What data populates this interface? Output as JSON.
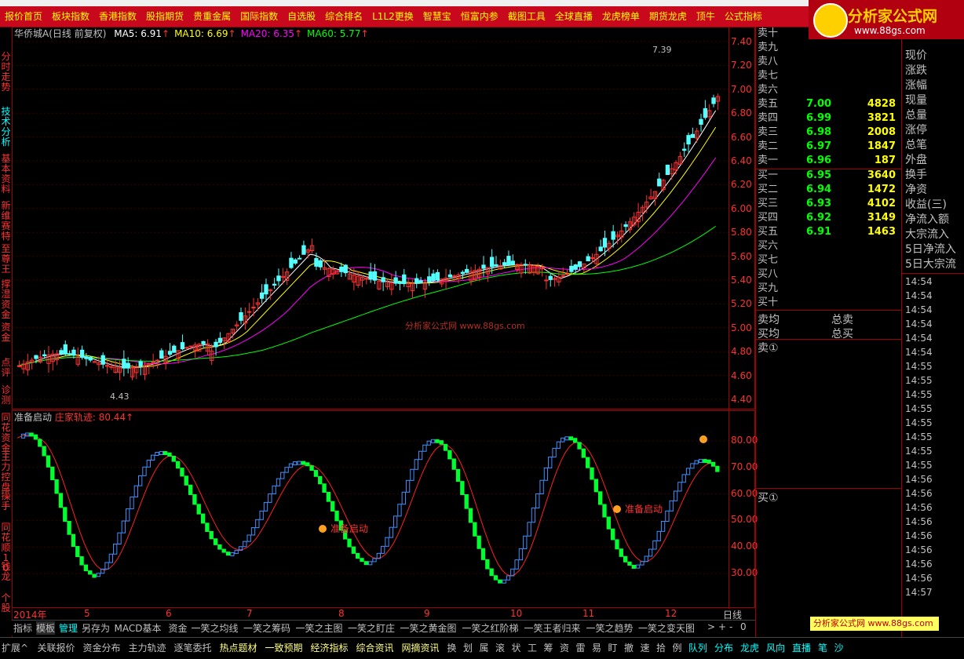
{
  "top_menu": [
    "报价首页",
    "板块指数",
    "香港指数",
    "股指期货",
    "贵重金属",
    "国际指数",
    "自选股",
    "综合排名",
    "L1L2更换",
    "智慧宝",
    "恒富内参",
    "截图工具",
    "全球直播",
    "龙虎榜单",
    "期货龙虎",
    "顶牛",
    "公式指标"
  ],
  "logo": {
    "title": "分析家公式网",
    "url": "www.88gs.com"
  },
  "left_tabs": [
    "分时走势",
    "技术分析",
    "基本资料",
    "新维赛特",
    "至尊王",
    "撑湿资金",
    "资金",
    "点评",
    "诊测",
    "同花资金",
    "主力控盘",
    "操手",
    "同花顺10",
    "钱龙",
    "个股"
  ],
  "price_chart": {
    "stock_name": "华侨城A(日线 前复权)",
    "ma": [
      {
        "label": "MA5:",
        "value": "6.91",
        "color": "#ffffff"
      },
      {
        "label": "MA10:",
        "value": "6.69",
        "color": "#ffff00"
      },
      {
        "label": "MA20:",
        "value": "6.35",
        "color": "#ff00ff"
      },
      {
        "label": "MA60:",
        "value": "5.77",
        "color": "#00ff00"
      }
    ],
    "high_label": "7.39",
    "low_label": "4.43",
    "watermark": "分析家公式网 www.88gs.com",
    "y_ticks": [
      "7.40",
      "7.20",
      "7.00",
      "6.80",
      "6.60",
      "6.40",
      "6.20",
      "6.00",
      "5.80",
      "5.60",
      "5.40",
      "5.20",
      "5.00",
      "4.80",
      "4.60",
      "4.40"
    ]
  },
  "ind_chart": {
    "name": "准备启动",
    "line_label": "庄家轨迹:",
    "line_value": "80.44",
    "signal_label": "准备启动",
    "y_ticks": [
      "80.00",
      "70.00",
      "60.00",
      "50.00",
      "40.00",
      "30.00"
    ]
  },
  "date_axis": {
    "year": "2014年",
    "months": [
      "5",
      "6",
      "7",
      "8",
      "9",
      "10",
      "11",
      "12"
    ],
    "period": "日线"
  },
  "tabs": [
    "指标",
    "模板",
    "管理",
    "另存为",
    "MACD基本",
    "资金",
    "一笑之均线",
    "一笑之筹码",
    "一笑之主图",
    "一笑之盯庄",
    "一笑之黄金图",
    "一笑之红阶梯",
    "一笑王者归来",
    "一笑之趋势",
    "一笑之变天图"
  ],
  "tab_controls": [
    ">",
    "+",
    "-",
    "0"
  ],
  "status_bar": [
    "扩展^",
    "关联报价",
    "资金分布",
    "主力轨迹",
    "逐笔委托",
    "热点题材",
    "一致预期",
    "经济指标",
    "综合资讯",
    "网摘资讯",
    "换",
    "划",
    "属",
    "滚",
    "状",
    "工",
    "筹",
    "资",
    "雷",
    "易",
    "盯",
    "撤",
    "速",
    "拾",
    "例",
    "队列",
    "分布",
    "龙虎",
    "风向",
    "直播",
    "笔",
    "沙"
  ],
  "order_book": {
    "sell": [
      {
        "name": "卖十",
        "price": "",
        "vol": ""
      },
      {
        "name": "卖九",
        "price": "",
        "vol": ""
      },
      {
        "name": "卖八",
        "price": "",
        "vol": ""
      },
      {
        "name": "卖七",
        "price": "",
        "vol": ""
      },
      {
        "name": "卖六",
        "price": "",
        "vol": ""
      },
      {
        "name": "卖五",
        "price": "7.00",
        "vol": "4828"
      },
      {
        "name": "卖四",
        "price": "6.99",
        "vol": "3821"
      },
      {
        "name": "卖三",
        "price": "6.98",
        "vol": "2008"
      },
      {
        "name": "卖二",
        "price": "6.97",
        "vol": "1847"
      },
      {
        "name": "卖一",
        "price": "6.96",
        "vol": "187"
      }
    ],
    "buy": [
      {
        "name": "买一",
        "price": "6.95",
        "vol": "3640"
      },
      {
        "name": "买二",
        "price": "6.94",
        "vol": "1472"
      },
      {
        "name": "买三",
        "price": "6.93",
        "vol": "4102"
      },
      {
        "name": "买四",
        "price": "6.92",
        "vol": "3149"
      },
      {
        "name": "买五",
        "price": "6.91",
        "vol": "1463"
      },
      {
        "name": "买六",
        "price": "",
        "vol": ""
      },
      {
        "name": "买七",
        "price": "",
        "vol": ""
      },
      {
        "name": "买八",
        "price": "",
        "vol": ""
      },
      {
        "name": "买九",
        "price": "",
        "vol": ""
      },
      {
        "name": "买十",
        "price": "",
        "vol": ""
      }
    ],
    "avg_sell": "卖均",
    "avg_buy": "买均",
    "total_sell": "总卖",
    "total_buy": "总买",
    "sell_queue": "卖①",
    "buy_queue": "买①"
  },
  "right_panel": {
    "fields": [
      "现价",
      "涨跌",
      "涨幅",
      "现量",
      "总量",
      "涨停",
      "总笔",
      "外盘",
      "换手",
      "净资",
      "收益(三)",
      "净流入额",
      "大宗流入",
      "5日净流入",
      "5日大宗流"
    ],
    "times": [
      "14:54",
      "14:54",
      "14:54",
      "14:54",
      "14:54",
      "14:54",
      "14:55",
      "14:55",
      "14:55",
      "14:55",
      "14:55",
      "14:55",
      "14:55",
      "14:55",
      "14:56",
      "14:56",
      "14:56",
      "14:56",
      "14:56",
      "14:56",
      "14:56",
      "14:56",
      "14:57"
    ]
  },
  "site_badge": "分析家公式网 www.88gs.com"
}
